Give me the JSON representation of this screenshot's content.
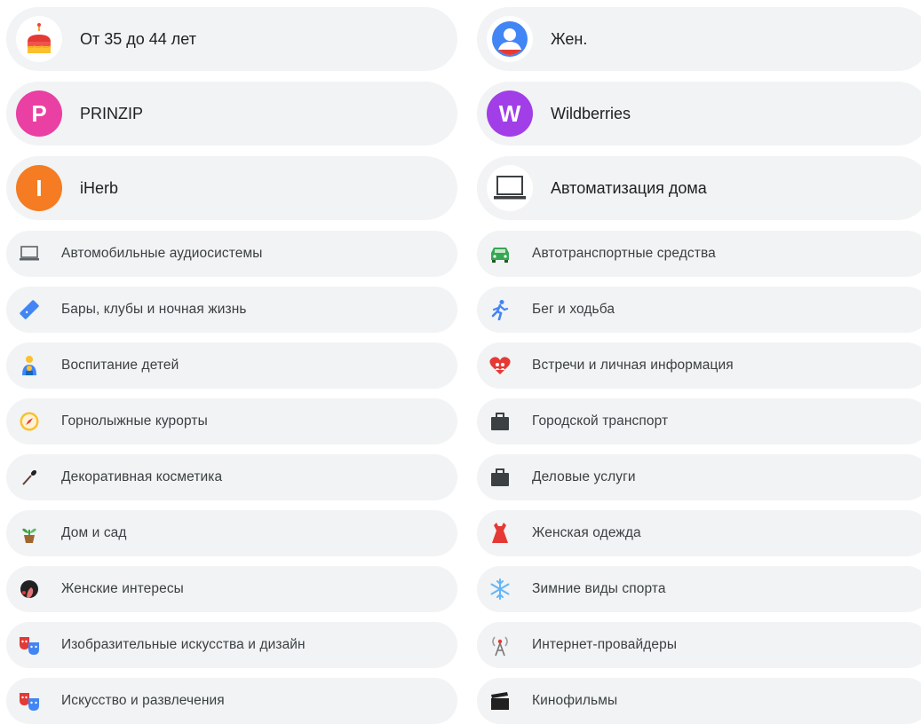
{
  "left": [
    {
      "label": "От 35 до 44 лет",
      "icon": "birthday-cake-icon"
    },
    {
      "label": "PRINZIP",
      "letter": "P",
      "color": "#ea3fa3"
    },
    {
      "label": "iHerb",
      "letter": "I",
      "color": "#f57c22"
    },
    {
      "label": "Автомобильные аудиосистемы",
      "icon": "laptop-icon"
    },
    {
      "label": "Бары, клубы и ночная жизнь",
      "icon": "ticket-icon"
    },
    {
      "label": "Воспитание детей",
      "icon": "parent-child-icon"
    },
    {
      "label": "Горнолыжные курорты",
      "icon": "compass-icon"
    },
    {
      "label": "Декоративная косметика",
      "icon": "makeup-brush-icon"
    },
    {
      "label": "Дом и сад",
      "icon": "potted-plant-icon"
    },
    {
      "label": "Женские интересы",
      "icon": "woman-profile-icon"
    },
    {
      "label": "Изобразительные искусства и дизайн",
      "icon": "theater-masks-icon"
    },
    {
      "label": "Искусство и развлечения",
      "icon": "theater-masks-icon"
    }
  ],
  "right": [
    {
      "label": "Жен.",
      "icon": "person-icon"
    },
    {
      "label": "Wildberries",
      "letter": "W",
      "color": "#a13ee8"
    },
    {
      "label": "Автоматизация дома",
      "icon": "laptop-icon"
    },
    {
      "label": "Автотранспортные средства",
      "icon": "car-icon"
    },
    {
      "label": "Бег и ходьба",
      "icon": "runner-icon"
    },
    {
      "label": "Встречи и личная информация",
      "icon": "heart-people-icon"
    },
    {
      "label": "Городской транспорт",
      "icon": "briefcase-icon"
    },
    {
      "label": "Деловые услуги",
      "icon": "briefcase-icon"
    },
    {
      "label": "Женская одежда",
      "icon": "dress-icon"
    },
    {
      "label": "Зимние виды спорта",
      "icon": "snowflake-icon"
    },
    {
      "label": "Интернет-провайдеры",
      "icon": "antenna-icon"
    },
    {
      "label": "Кинофильмы",
      "icon": "clapperboard-icon"
    }
  ]
}
